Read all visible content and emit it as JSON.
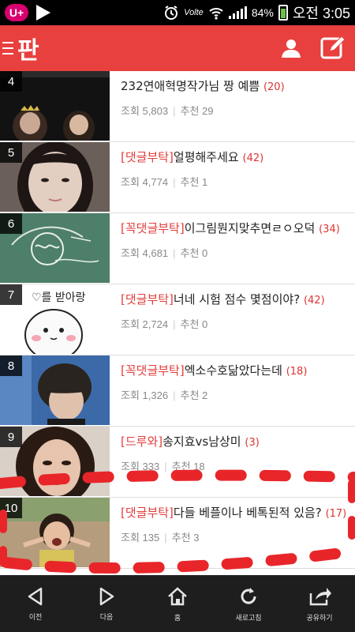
{
  "status_bar": {
    "carrier": "U+",
    "volte": "Volte",
    "battery": "84%",
    "time": "오전 3:05"
  },
  "app": {
    "logo": "판",
    "icons": [
      "menu-icon",
      "profile-icon",
      "write-icon"
    ]
  },
  "posts": [
    {
      "rank": "4",
      "tag": "",
      "title": "232연애혁명작가님 짱 예쁨",
      "count": "(20)",
      "views_label": "조회",
      "views": "5,803",
      "recommend_label": "추천",
      "recommend": "29"
    },
    {
      "rank": "5",
      "tag": "[댓글부탁]",
      "title": "얼평해주세요",
      "count": "(42)",
      "views_label": "조회",
      "views": "4,774",
      "recommend_label": "추천",
      "recommend": "1"
    },
    {
      "rank": "6",
      "tag": "[꼭댓글부탁]",
      "title": "이그림뭔지맞추면ㄹㅇ오덕",
      "count": "(34)",
      "views_label": "조회",
      "views": "4,681",
      "recommend_label": "추천",
      "recommend": "0"
    },
    {
      "rank": "7",
      "tag": "[댓글부탁]",
      "title": "너네 시험 점수 몇점이야?",
      "count": "(42)",
      "views_label": "조회",
      "views": "2,724",
      "recommend_label": "추천",
      "recommend": "0"
    },
    {
      "rank": "8",
      "tag": "[꼭댓글부탁]",
      "title": "엑소수호닮았다는데",
      "count": "(18)",
      "views_label": "조회",
      "views": "1,326",
      "recommend_label": "추천",
      "recommend": "2"
    },
    {
      "rank": "9",
      "tag": "[드루와]",
      "title": "송지효vs남상미",
      "count": "(3)",
      "views_label": "조회",
      "views": "333",
      "recommend_label": "추천",
      "recommend": "18"
    },
    {
      "rank": "10",
      "tag": "[댓글부탁]",
      "title": "다들 베플이나 베톡된적 있음?",
      "count": "(17)",
      "views_label": "조회",
      "views": "135",
      "recommend_label": "추천",
      "recommend": "3"
    }
  ],
  "thumb_text": {
    "post7": "♡를 받아랑"
  },
  "bottom_nav": [
    {
      "label": "이전",
      "icon": "back-arrow-icon"
    },
    {
      "label": "다음",
      "icon": "forward-arrow-icon"
    },
    {
      "label": "홈",
      "icon": "home-icon"
    },
    {
      "label": "새로고침",
      "icon": "refresh-icon"
    },
    {
      "label": "공유하기",
      "icon": "share-icon"
    }
  ],
  "colors": {
    "accent": "#e8403e",
    "tag": "#e33c3c",
    "annotation": "#e8262a"
  }
}
